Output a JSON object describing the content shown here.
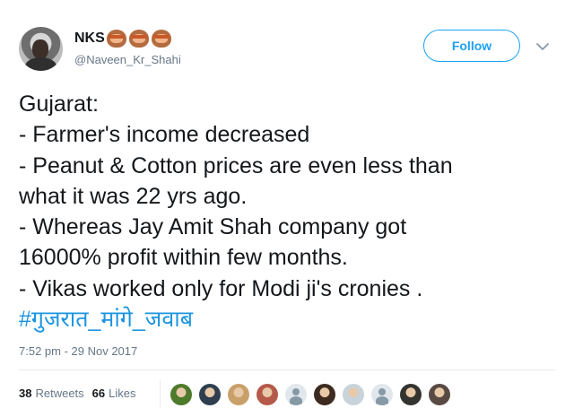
{
  "author": {
    "display_name": "NKS",
    "handle": "@Naveen_Kr_Shahi",
    "emojis": [
      "see-no-evil-monkey",
      "hear-no-evil-monkey",
      "speak-no-evil-monkey"
    ]
  },
  "follow_label": "Follow",
  "tweet": {
    "lines": [
      "Gujarat:",
      "- Farmer's income decreased",
      "- Peanut & Cotton prices are even less than",
      "what it was 22 yrs ago.",
      "- Whereas Jay Amit Shah company got",
      "16000% profit within few months.",
      "- Vikas worked only for Modi ji's cronies ."
    ],
    "hashtag": "#गुजरात_मांगे_जवाब"
  },
  "timestamp": "7:52 pm - 29 Nov 2017",
  "stats": {
    "retweets_count": "38",
    "retweets_label": "Retweets",
    "likes_count": "66",
    "likes_label": "Likes"
  },
  "likers": [
    {
      "kind": "photo",
      "color": "#4d7a2b"
    },
    {
      "kind": "photo",
      "color": "#2f3f4f"
    },
    {
      "kind": "photo",
      "color": "#c9a06a"
    },
    {
      "kind": "photo",
      "color": "#b55a4a"
    },
    {
      "kind": "default",
      "color": "#e1e8ed"
    },
    {
      "kind": "photo",
      "color": "#3d2b1f"
    },
    {
      "kind": "photo",
      "color": "#c8d3db"
    },
    {
      "kind": "default",
      "color": "#e1e8ed"
    },
    {
      "kind": "photo",
      "color": "#33332f"
    },
    {
      "kind": "photo",
      "color": "#5a4a44"
    }
  ],
  "colors": {
    "accent": "#1da1f2",
    "hashtag": "#1b95e0",
    "secondary_text": "#657786"
  }
}
